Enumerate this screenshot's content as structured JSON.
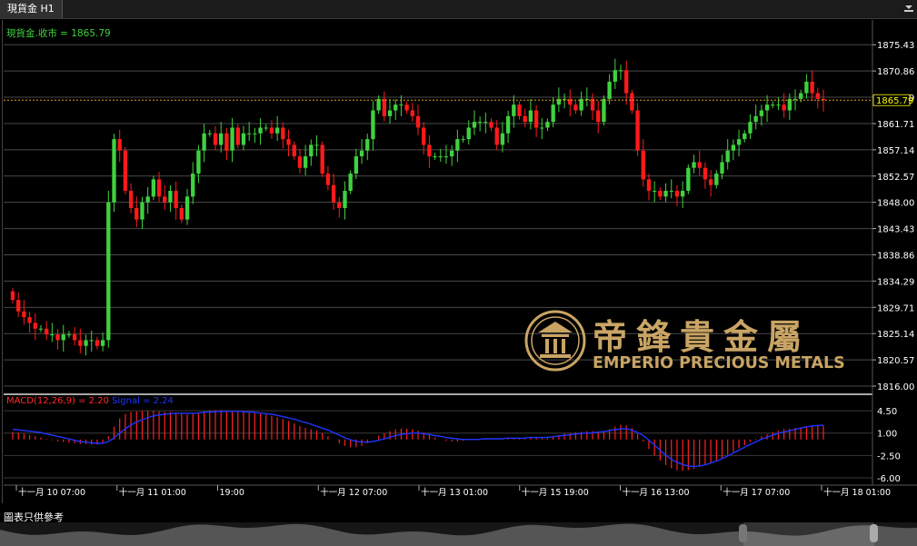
{
  "tab": {
    "title": "現貨金 H1"
  },
  "price_label": "現貨金.收市 = 1865.79",
  "current_price": "1865.79",
  "macd_label": {
    "main": "MACD(12,26,9) = 2.20",
    "signal": "Signal = 2.24"
  },
  "footer_note": "圖表只供參考",
  "logo": {
    "chinese": "帝鋒貴金屬",
    "english": "EMPERIO PRECIOUS METALS"
  },
  "colors": {
    "up": "#3fd23f",
    "down": "#ff1a1a",
    "macd": "#ff2020",
    "signal": "#1e35ff",
    "price_line": "#e8a020",
    "axis_text": "#ffffff",
    "current": "#ffff00"
  },
  "chart_data": {
    "type": "candlestick",
    "title": "現貨金 H1",
    "price_axis": [
      "1875.43",
      "1870.86",
      "1866.29",
      "1861.71",
      "1857.14",
      "1852.57",
      "1848.00",
      "1843.43",
      "1838.86",
      "1834.29",
      "1829.71",
      "1825.14",
      "1820.57",
      "1816.00"
    ],
    "ylim": [
      1816.0,
      1878.0
    ],
    "macd_axis": [
      "4.50",
      "1.00",
      "-2.50",
      "-6.00"
    ],
    "macd_ylim": [
      -7.0,
      6.5
    ],
    "x_ticks": [
      "十一月 10 07:00",
      "十一月 11 01:00",
      "19:00",
      "十一月 12 07:00",
      "十一月 13 01:00",
      "十一月 15 19:00",
      "十一月 16 13:00",
      "十一月 17 07:00",
      "十一月 18 01:00"
    ],
    "close": [
      1831,
      1829,
      1828,
      1827,
      1826,
      1826,
      1825,
      1825,
      1824,
      1825,
      1825,
      1824,
      1823,
      1824,
      1824,
      1823,
      1824,
      1848,
      1859,
      1857,
      1850,
      1847,
      1845,
      1848,
      1849,
      1852,
      1849,
      1848,
      1850,
      1847,
      1845,
      1849,
      1853,
      1857,
      1860,
      1860,
      1858,
      1860,
      1857,
      1861,
      1858,
      1860,
      1860,
      1860,
      1861,
      1861,
      1860,
      1861,
      1859,
      1858,
      1856,
      1854,
      1856,
      1858,
      1858,
      1853,
      1851,
      1848,
      1847,
      1850,
      1853,
      1856,
      1857,
      1859,
      1864,
      1866,
      1863,
      1864,
      1865,
      1865,
      1864,
      1863,
      1861,
      1858,
      1856,
      1856,
      1856,
      1856,
      1857,
      1859,
      1859,
      1861,
      1862,
      1862,
      1862,
      1861,
      1858,
      1860,
      1863,
      1865,
      1863,
      1862,
      1864,
      1861,
      1861,
      1862,
      1865,
      1866,
      1866,
      1865,
      1864,
      1866,
      1866,
      1864,
      1862,
      1866,
      1869,
      1871,
      1871,
      1867,
      1864,
      1857,
      1852,
      1850,
      1850,
      1849,
      1850,
      1850,
      1849,
      1850,
      1854,
      1855,
      1854,
      1852,
      1851,
      1853,
      1855,
      1857,
      1858,
      1859,
      1860,
      1862,
      1863,
      1864,
      1865,
      1865,
      1865,
      1864,
      1866,
      1866,
      1867,
      1869,
      1867,
      1866,
      1865.79
    ],
    "macd_hist": [
      1.2,
      1.1,
      0.9,
      0.7,
      0.5,
      0.3,
      0.1,
      -0.1,
      -0.3,
      -0.4,
      -0.5,
      -0.6,
      -0.7,
      -0.7,
      -0.8,
      -0.8,
      -0.7,
      0.5,
      2.0,
      3.3,
      4.0,
      4.3,
      4.4,
      4.5,
      4.5,
      4.5,
      4.4,
      4.3,
      4.3,
      4.2,
      4.0,
      3.9,
      4.0,
      4.2,
      4.4,
      4.6,
      4.6,
      4.6,
      4.5,
      4.5,
      4.4,
      4.3,
      4.2,
      4.1,
      4.0,
      3.9,
      3.7,
      3.5,
      3.2,
      2.9,
      2.5,
      2.1,
      1.8,
      1.6,
      1.4,
      1.0,
      0.5,
      0.0,
      -0.6,
      -1.0,
      -1.2,
      -1.2,
      -1.0,
      -0.6,
      0.0,
      0.6,
      1.0,
      1.3,
      1.6,
      1.7,
      1.7,
      1.6,
      1.4,
      1.1,
      0.7,
      0.3,
      0.0,
      -0.2,
      -0.3,
      -0.3,
      -0.2,
      -0.1,
      0.0,
      0.1,
      0.2,
      0.2,
      0.1,
      0.1,
      0.2,
      0.3,
      0.3,
      0.3,
      0.4,
      0.3,
      0.3,
      0.3,
      0.5,
      0.7,
      0.9,
      1.0,
      1.1,
      1.2,
      1.3,
      1.3,
      1.2,
      1.3,
      1.6,
      2.0,
      2.3,
      2.2,
      1.8,
      0.9,
      -0.3,
      -1.5,
      -2.5,
      -3.3,
      -4.0,
      -4.5,
      -4.8,
      -4.9,
      -4.8,
      -4.6,
      -4.3,
      -4.0,
      -3.7,
      -3.3,
      -2.9,
      -2.4,
      -1.9,
      -1.4,
      -0.9,
      -0.4,
      0.1,
      0.5,
      0.8,
      1.1,
      1.4,
      1.6,
      1.7,
      1.8,
      1.9,
      2.0,
      2.1,
      2.2,
      2.2
    ],
    "macd_signal": [
      1.6,
      1.5,
      1.4,
      1.3,
      1.2,
      1.1,
      0.9,
      0.7,
      0.5,
      0.3,
      0.1,
      -0.1,
      -0.3,
      -0.4,
      -0.5,
      -0.6,
      -0.6,
      -0.4,
      0.1,
      0.8,
      1.5,
      2.1,
      2.6,
      3.0,
      3.3,
      3.6,
      3.8,
      3.9,
      4.0,
      4.1,
      4.1,
      4.1,
      4.1,
      4.1,
      4.2,
      4.3,
      4.3,
      4.4,
      4.4,
      4.4,
      4.4,
      4.4,
      4.3,
      4.3,
      4.2,
      4.1,
      4.0,
      3.9,
      3.7,
      3.5,
      3.3,
      3.1,
      2.8,
      2.6,
      2.3,
      2.0,
      1.7,
      1.4,
      1.0,
      0.6,
      0.2,
      -0.1,
      -0.3,
      -0.4,
      -0.4,
      -0.3,
      -0.1,
      0.1,
      0.4,
      0.6,
      0.8,
      0.9,
      1.0,
      1.0,
      0.9,
      0.8,
      0.6,
      0.5,
      0.3,
      0.2,
      0.1,
      0.0,
      0.0,
      0.0,
      0.0,
      0.1,
      0.1,
      0.1,
      0.1,
      0.2,
      0.2,
      0.2,
      0.2,
      0.3,
      0.3,
      0.3,
      0.3,
      0.4,
      0.5,
      0.6,
      0.7,
      0.8,
      0.9,
      1.0,
      1.0,
      1.1,
      1.2,
      1.3,
      1.5,
      1.6,
      1.7,
      1.6,
      1.3,
      0.9,
      0.3,
      -0.4,
      -1.2,
      -2.0,
      -2.7,
      -3.3,
      -3.7,
      -4.0,
      -4.2,
      -4.2,
      -4.1,
      -3.9,
      -3.6,
      -3.3,
      -2.9,
      -2.5,
      -2.0,
      -1.6,
      -1.1,
      -0.7,
      -0.3,
      0.1,
      0.4,
      0.7,
      1.0,
      1.2,
      1.4,
      1.6,
      1.8,
      2.0,
      2.1,
      2.2,
      2.24
    ]
  }
}
